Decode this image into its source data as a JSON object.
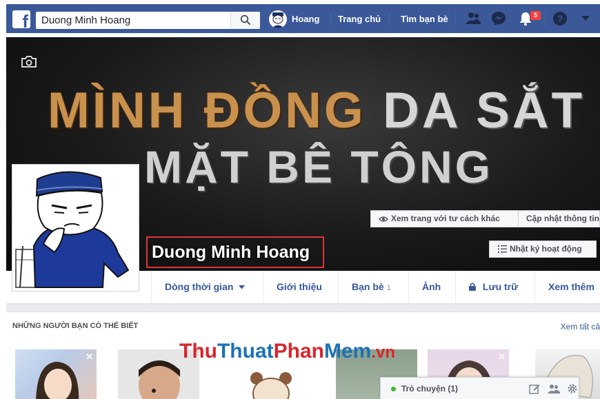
{
  "nav": {
    "logo": "f",
    "search_value": "Duong Minh Hoang",
    "user_name": "Hoang",
    "home": "Trang chủ",
    "find_friends": "Tìm bạn bè",
    "notif_count": "5"
  },
  "cover": {
    "line1_part1": "MÌNH ĐỒNG",
    "line1_part2": "DA SẮT",
    "line2": "MẶT BÊ TÔNG",
    "view_as": "Xem trang với tư cách khác",
    "update_info": "Cập nhật thông tin",
    "activity_log": "Nhật ký hoạt động",
    "profile_name": "Duong Minh Hoang"
  },
  "tabs": [
    {
      "label": "Dòng thời gian"
    },
    {
      "label": "Giới thiệu"
    },
    {
      "label": "Bạn bè",
      "count": "1"
    },
    {
      "label": "Ảnh"
    },
    {
      "label": "Lưu trữ"
    },
    {
      "label": "Xem thêm"
    }
  ],
  "people": {
    "title": "NHỮNG NGƯỜI BẠN CÓ THỂ BIẾT",
    "see_all": "Xem tất cả",
    "close_glyph": "✕"
  },
  "watermark": {
    "thu": "Thu",
    "thuat": "Thuat",
    "phan": "Phan",
    "mem": "Mem",
    "vn": ".vn"
  },
  "chat": {
    "label": "Trò chuyện (1)"
  },
  "colors": {
    "fb_blue": "#3b5998",
    "link_blue": "#365899",
    "online_green": "#42b72a",
    "badge_red": "#fa3e3e"
  }
}
